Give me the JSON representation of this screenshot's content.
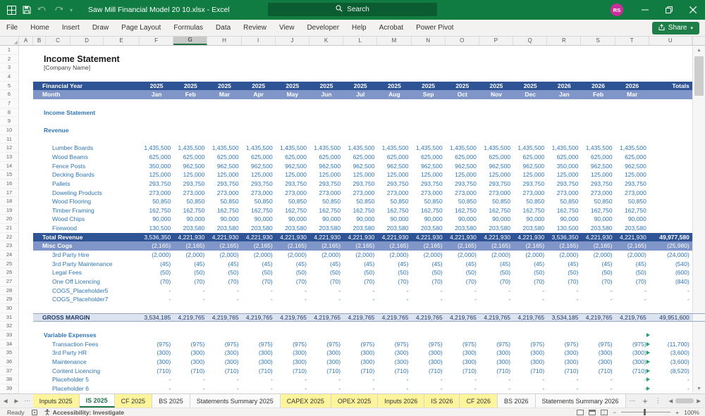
{
  "colors": {
    "excel_green": "#107C41",
    "search_green": "#0B5C30",
    "band_dark_blue": "#2F5496",
    "band_mid_blue": "#8096C8",
    "band_light_blue": "#DCE3F0",
    "value_blue": "#2E75B6",
    "tab_yellow": "#FEF49C",
    "share_green": "#1D7E48",
    "avatar_magenta": "#CB2E9A",
    "flag_green": "#21A366"
  },
  "titlebar": {
    "title": "Saw Mill Financial Model 20 10.xlsx - Excel",
    "search_placeholder": "Search",
    "avatar_initials": "RS"
  },
  "ribbon": {
    "tabs": [
      "File",
      "Home",
      "Insert",
      "Draw",
      "Page Layout",
      "Formulas",
      "Data",
      "Review",
      "View",
      "Developer",
      "Help",
      "Acrobat",
      "Power Pivot"
    ],
    "share_label": "Share"
  },
  "columns": {
    "letters": [
      "A",
      "B",
      "C",
      "D",
      "E",
      "F",
      "G",
      "H",
      "I",
      "J",
      "K",
      "L",
      "M",
      "N",
      "O",
      "P",
      "Q",
      "R",
      "S",
      "T",
      "U"
    ],
    "selected": "G"
  },
  "sheet": {
    "rows": [
      {
        "n": 1,
        "t": "empty"
      },
      {
        "n": 2,
        "t": "title",
        "label": "Income Statement"
      },
      {
        "n": 3,
        "t": "subtitle",
        "label": "[Company Name]"
      },
      {
        "n": 4,
        "t": "empty"
      },
      {
        "n": 5,
        "t": "yearband",
        "label": "Financial Year",
        "v": [
          "2025",
          "2025",
          "2025",
          "2025",
          "2025",
          "2025",
          "2025",
          "2025",
          "2025",
          "2025",
          "2025",
          "2025",
          "2026",
          "2026",
          "2026"
        ],
        "total": "Totals"
      },
      {
        "n": 6,
        "t": "monthband",
        "label": "Month",
        "v": [
          "Jan",
          "Feb",
          "Mar",
          "Apr",
          "May",
          "Jun",
          "Jul",
          "Aug",
          "Sep",
          "Oct",
          "Nov",
          "Dec",
          "Jan",
          "Feb",
          "Mar"
        ],
        "total": ""
      },
      {
        "n": 7,
        "t": "empty"
      },
      {
        "n": 8,
        "t": "section",
        "label": "Income Statement"
      },
      {
        "n": 9,
        "t": "empty"
      },
      {
        "n": 10,
        "t": "section",
        "label": "Revenue"
      },
      {
        "n": 11,
        "t": "empty"
      },
      {
        "n": 12,
        "t": "item",
        "label": "Lumber Boards",
        "v": [
          "1,435,500",
          "1,435,500",
          "1,435,500",
          "1,435,500",
          "1,435,500",
          "1,435,500",
          "1,435,500",
          "1,435,500",
          "1,435,500",
          "1,435,500",
          "1,435,500",
          "1,435,500",
          "1,435,500",
          "1,435,500",
          "1,435,500"
        ],
        "total": ""
      },
      {
        "n": 13,
        "t": "item",
        "label": "Wood Beams",
        "v": [
          "625,000",
          "625,000",
          "625,000",
          "625,000",
          "625,000",
          "625,000",
          "625,000",
          "625,000",
          "625,000",
          "625,000",
          "625,000",
          "625,000",
          "625,000",
          "625,000",
          "625,000"
        ],
        "total": ""
      },
      {
        "n": 14,
        "t": "item",
        "label": "Fence Posts",
        "v": [
          "350,000",
          "962,500",
          "962,500",
          "962,500",
          "962,500",
          "962,500",
          "962,500",
          "962,500",
          "962,500",
          "962,500",
          "962,500",
          "962,500",
          "350,000",
          "962,500",
          "962,500"
        ],
        "total": ""
      },
      {
        "n": 15,
        "t": "item",
        "label": "Decking Boards",
        "v": [
          "125,000",
          "125,000",
          "125,000",
          "125,000",
          "125,000",
          "125,000",
          "125,000",
          "125,000",
          "125,000",
          "125,000",
          "125,000",
          "125,000",
          "125,000",
          "125,000",
          "125,000"
        ],
        "total": ""
      },
      {
        "n": 16,
        "t": "item",
        "label": "Pallets",
        "v": [
          "293,750",
          "293,750",
          "293,750",
          "293,750",
          "293,750",
          "293,750",
          "293,750",
          "293,750",
          "293,750",
          "293,750",
          "293,750",
          "293,750",
          "293,750",
          "293,750",
          "293,750"
        ],
        "total": ""
      },
      {
        "n": 17,
        "t": "item",
        "label": "Doweling Products",
        "v": [
          "273,000",
          "273,000",
          "273,000",
          "273,000",
          "273,000",
          "273,000",
          "273,000",
          "273,000",
          "273,000",
          "273,000",
          "273,000",
          "273,000",
          "273,000",
          "273,000",
          "273,000"
        ],
        "total": ""
      },
      {
        "n": 18,
        "t": "item",
        "label": "Wood Flooring",
        "v": [
          "50,850",
          "50,850",
          "50,850",
          "50,850",
          "50,850",
          "50,850",
          "50,850",
          "50,850",
          "50,850",
          "50,850",
          "50,850",
          "50,850",
          "50,850",
          "50,850",
          "50,850"
        ],
        "total": ""
      },
      {
        "n": 19,
        "t": "item",
        "label": "Timber Framing",
        "v": [
          "162,750",
          "162,750",
          "162,750",
          "162,750",
          "162,750",
          "162,750",
          "162,750",
          "162,750",
          "162,750",
          "162,750",
          "162,750",
          "162,750",
          "162,750",
          "162,750",
          "162,750"
        ],
        "total": ""
      },
      {
        "n": 20,
        "t": "item",
        "label": "Wood Chips",
        "v": [
          "90,000",
          "90,000",
          "90,000",
          "90,000",
          "90,000",
          "90,000",
          "90,000",
          "90,000",
          "90,000",
          "90,000",
          "90,000",
          "90,000",
          "90,000",
          "90,000",
          "90,000"
        ],
        "total": ""
      },
      {
        "n": 21,
        "t": "item",
        "label": "Firewood",
        "v": [
          "130,500",
          "203,580",
          "203,580",
          "203,580",
          "203,580",
          "203,580",
          "203,580",
          "203,580",
          "203,580",
          "203,580",
          "203,580",
          "203,580",
          "130,500",
          "203,580",
          "203,580"
        ],
        "total": ""
      },
      {
        "n": 22,
        "t": "totaldark",
        "label": "Total Revenue",
        "v": [
          "3,536,350",
          "4,221,930",
          "4,221,930",
          "4,221,930",
          "4,221,930",
          "4,221,930",
          "4,221,930",
          "4,221,930",
          "4,221,930",
          "4,221,930",
          "4,221,930",
          "4,221,930",
          "3,536,350",
          "4,221,930",
          "4,221,930"
        ],
        "total": "49,977,580"
      },
      {
        "n": 23,
        "t": "bandmid",
        "label": "Misc Cogs",
        "v": [
          "(2,165)",
          "(2,165)",
          "(2,165)",
          "(2,165)",
          "(2,165)",
          "(2,165)",
          "(2,165)",
          "(2,165)",
          "(2,165)",
          "(2,165)",
          "(2,165)",
          "(2,165)",
          "(2,165)",
          "(2,165)",
          "(2,165)"
        ],
        "total": "(25,980)"
      },
      {
        "n": 24,
        "t": "item",
        "label": "3rd Party Hire",
        "v": [
          "(2,000)",
          "(2,000)",
          "(2,000)",
          "(2,000)",
          "(2,000)",
          "(2,000)",
          "(2,000)",
          "(2,000)",
          "(2,000)",
          "(2,000)",
          "(2,000)",
          "(2,000)",
          "(2,000)",
          "(2,000)",
          "(2,000)"
        ],
        "total": "(24,000)"
      },
      {
        "n": 25,
        "t": "item",
        "label": "3rd Party Maintenance",
        "v": [
          "(45)",
          "(45)",
          "(45)",
          "(45)",
          "(45)",
          "(45)",
          "(45)",
          "(45)",
          "(45)",
          "(45)",
          "(45)",
          "(45)",
          "(45)",
          "(45)",
          "(45)"
        ],
        "total": "(540)"
      },
      {
        "n": 26,
        "t": "item",
        "label": "Legal Fees",
        "v": [
          "(50)",
          "(50)",
          "(50)",
          "(50)",
          "(50)",
          "(50)",
          "(50)",
          "(50)",
          "(50)",
          "(50)",
          "(50)",
          "(50)",
          "(50)",
          "(50)",
          "(50)"
        ],
        "total": "(600)"
      },
      {
        "n": 27,
        "t": "item",
        "label": "One Off Licencing",
        "v": [
          "(70)",
          "(70)",
          "(70)",
          "(70)",
          "(70)",
          "(70)",
          "(70)",
          "(70)",
          "(70)",
          "(70)",
          "(70)",
          "(70)",
          "(70)",
          "(70)",
          "(70)"
        ],
        "total": "(840)"
      },
      {
        "n": 28,
        "t": "item",
        "label": "COGS_Placeholder5",
        "v": [
          "-",
          "-",
          "-",
          "-",
          "-",
          "-",
          "-",
          "-",
          "-",
          "-",
          "-",
          "-",
          "-",
          "-",
          "-"
        ],
        "total": "-"
      },
      {
        "n": 29,
        "t": "item",
        "label": "COGS_Placeholder7",
        "v": [
          "-",
          "-",
          "-",
          "-",
          "-",
          "-",
          "-",
          "-",
          "-",
          "-",
          "-",
          "-",
          "-",
          "-",
          "-"
        ],
        "total": "-"
      },
      {
        "n": 30,
        "t": "empty"
      },
      {
        "n": 31,
        "t": "gm",
        "label": "GROSS MARGIN",
        "v": [
          "3,534,185",
          "4,219,765",
          "4,219,765",
          "4,219,765",
          "4,219,765",
          "4,219,765",
          "4,219,765",
          "4,219,765",
          "4,219,765",
          "4,219,765",
          "4,219,765",
          "4,219,765",
          "3,534,185",
          "4,219,765",
          "4,219,765"
        ],
        "total": "49,951,600"
      },
      {
        "n": 32,
        "t": "empty"
      },
      {
        "n": 33,
        "t": "section",
        "label": "Variable Expenses",
        "flag": true
      },
      {
        "n": 34,
        "t": "item",
        "label": "Transaction Fees",
        "v": [
          "(975)",
          "(975)",
          "(975)",
          "(975)",
          "(975)",
          "(975)",
          "(975)",
          "(975)",
          "(975)",
          "(975)",
          "(975)",
          "(975)",
          "(975)",
          "(975)",
          "(975)"
        ],
        "total": "(11,700)",
        "flag": true
      },
      {
        "n": 35,
        "t": "item",
        "label": "3rd Party HR",
        "v": [
          "(300)",
          "(300)",
          "(300)",
          "(300)",
          "(300)",
          "(300)",
          "(300)",
          "(300)",
          "(300)",
          "(300)",
          "(300)",
          "(300)",
          "(300)",
          "(300)",
          "(300)"
        ],
        "total": "(3,600)",
        "flag": true
      },
      {
        "n": 36,
        "t": "item",
        "label": "Maintenance",
        "v": [
          "(300)",
          "(300)",
          "(300)",
          "(300)",
          "(300)",
          "(300)",
          "(300)",
          "(300)",
          "(300)",
          "(300)",
          "(300)",
          "(300)",
          "(300)",
          "(300)",
          "(300)"
        ],
        "total": "(3,600)",
        "flag": true
      },
      {
        "n": 37,
        "t": "item",
        "label": "Content Licencing",
        "v": [
          "(710)",
          "(710)",
          "(710)",
          "(710)",
          "(710)",
          "(710)",
          "(710)",
          "(710)",
          "(710)",
          "(710)",
          "(710)",
          "(710)",
          "(710)",
          "(710)",
          "(710)"
        ],
        "total": "(8,520)",
        "flag": true
      },
      {
        "n": 38,
        "t": "item",
        "label": "Placeholder 5",
        "v": [
          "-",
          "-",
          "-",
          "-",
          "-",
          "-",
          "-",
          "-",
          "-",
          "-",
          "-",
          "-",
          "-",
          "-",
          "-"
        ],
        "total": "-",
        "flag": true
      },
      {
        "n": 39,
        "t": "item",
        "label": "Placeholder 6",
        "v": [
          "-",
          "-",
          "-",
          "-",
          "-",
          "-",
          "-",
          "-",
          "-",
          "-",
          "-",
          "-",
          "-",
          "-",
          "-"
        ],
        "total": "-",
        "flag": true
      }
    ]
  },
  "tabbar": {
    "tabs": [
      {
        "label": "Inputs 2025",
        "style": "yellow"
      },
      {
        "label": "IS 2025",
        "style": "active"
      },
      {
        "label": "CF 2025",
        "style": "yellow"
      },
      {
        "label": "BS 2025",
        "style": "plain"
      },
      {
        "label": "Statements Summary 2025",
        "style": "plain"
      },
      {
        "label": "CAPEX 2025",
        "style": "yellow"
      },
      {
        "label": "OPEX 2025",
        "style": "yellow"
      },
      {
        "label": "Inputs 2026",
        "style": "yellow"
      },
      {
        "label": "IS 2026",
        "style": "yellow"
      },
      {
        "label": "CF 2026",
        "style": "yellow"
      },
      {
        "label": "BS 2026",
        "style": "plain"
      },
      {
        "label": "Statements Summary 2026",
        "style": "plain"
      }
    ],
    "overflow": "⋯",
    "add_sheet": "+",
    "more": "⋮"
  },
  "statusbar": {
    "ready": "Ready",
    "accessibility": "Accessibility: Investigate",
    "zoom_level": "100%"
  }
}
